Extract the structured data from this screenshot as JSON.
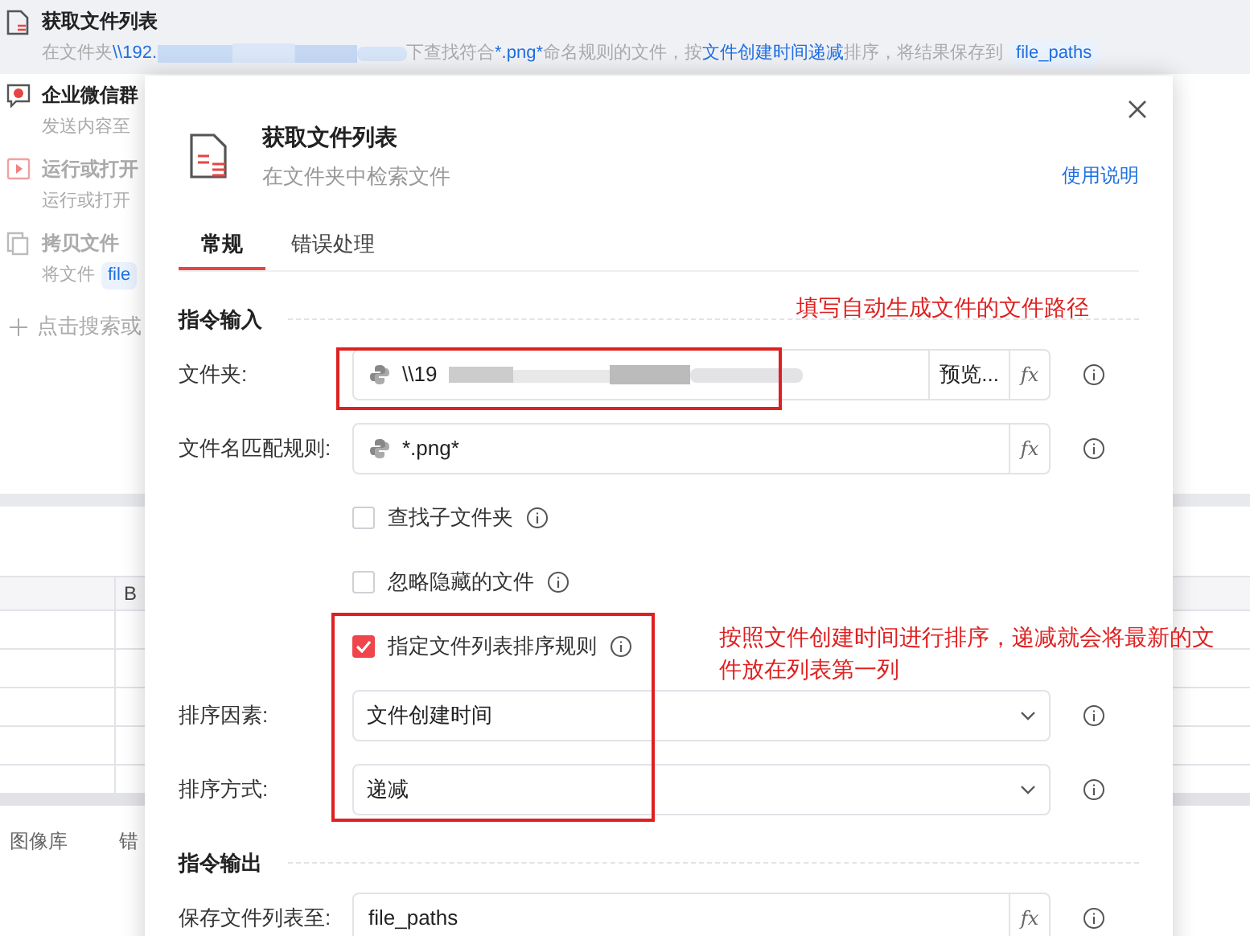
{
  "background": {
    "items": [
      {
        "title": "获取文件列表",
        "selected": true,
        "dimmed": false,
        "desc": [
          {
            "kind": "plain",
            "text": "在文件夹"
          },
          {
            "kind": "link",
            "text": "\\\\192."
          },
          {
            "kind": "redacted"
          },
          {
            "kind": "plain",
            "text": "下查找符合"
          },
          {
            "kind": "link",
            "text": "*.png*"
          },
          {
            "kind": "plain",
            "text": "命名规则的文件，按"
          },
          {
            "kind": "link",
            "text": "文件创建时间递减"
          },
          {
            "kind": "plain",
            "text": "排序，将结果保存到"
          },
          {
            "kind": "chip",
            "text": "file_paths"
          }
        ]
      },
      {
        "title": "企业微信群",
        "selected": false,
        "dimmed": false,
        "desc": [
          {
            "kind": "plain",
            "text": "发送内容至"
          }
        ]
      },
      {
        "title": "运行或打开",
        "selected": false,
        "dimmed": true,
        "desc": [
          {
            "kind": "plain",
            "text": "运行或打开"
          }
        ]
      },
      {
        "title": "拷贝文件",
        "selected": false,
        "dimmed": true,
        "desc": [
          {
            "kind": "plain",
            "text": "将文件"
          },
          {
            "kind": "chip",
            "text": "file"
          }
        ]
      }
    ],
    "add_hint": "点击搜索或",
    "table": {
      "column_2": "B"
    },
    "bottom_tabs": [
      "图像库",
      "错"
    ]
  },
  "dialog": {
    "title": "获取文件列表",
    "subtitle": "在文件夹中检索文件",
    "help_link": "使用说明",
    "tabs": [
      {
        "label": "常规",
        "selected": true
      },
      {
        "label": "错误处理",
        "selected": false
      }
    ],
    "sections": [
      {
        "title": "指令输入",
        "rows": [
          {
            "kind": "field",
            "label": "文件夹:",
            "value": "\\\\19",
            "python": true,
            "redacted": true,
            "preview": "预览...",
            "formula": "fx"
          },
          {
            "kind": "field",
            "label": "文件名匹配规则:",
            "value": "*.png*",
            "python": true,
            "redacted": false,
            "formula": "fx"
          },
          {
            "kind": "checkbox",
            "label": "查找子文件夹",
            "checked": false
          },
          {
            "kind": "checkbox",
            "label": "忽略隐藏的文件",
            "checked": false
          },
          {
            "kind": "checkbox",
            "label": "指定文件列表排序规则",
            "checked": true
          },
          {
            "kind": "select",
            "label": "排序因素:",
            "value": "文件创建时间"
          },
          {
            "kind": "select",
            "label": "排序方式:",
            "value": "递减"
          }
        ]
      },
      {
        "title": "指令输出",
        "rows": [
          {
            "kind": "field",
            "label": "保存文件列表至:",
            "value": "file_paths",
            "python": false,
            "redacted": false,
            "formula": "fx"
          }
        ]
      }
    ]
  },
  "annotations": [
    "填写自动生成文件的文件路径",
    "按照文件创建时间进行排序，递减就会将最新的文件放在列表第一列"
  ]
}
